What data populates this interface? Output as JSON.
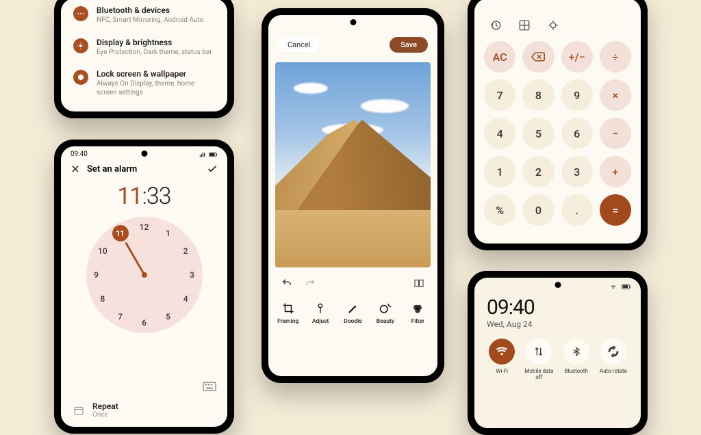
{
  "colors": {
    "accent": "#a24a1d",
    "bg": "#f4ebd7",
    "key_bg": "#f6eedd",
    "key_op": "#f3e0d8"
  },
  "settings": {
    "items": [
      {
        "title": "Bluetooth & devices",
        "sub": "NFC, Smart Mirroring, Android Auto"
      },
      {
        "title": "Display & brightness",
        "sub": "Eye Protection, Dark theme, status bar"
      },
      {
        "title": "Lock screen & wallpaper",
        "sub": "Always On Display, theme, home screen settings"
      }
    ]
  },
  "alarm": {
    "status_time": "09:40",
    "title": "Set an alarm",
    "hour": "11",
    "minute": "33",
    "selected_hour": "11",
    "repeat_label": "Repeat",
    "repeat_value": "Once"
  },
  "editor": {
    "cancel": "Cancel",
    "save": "Save",
    "tools": [
      {
        "label": "Framing"
      },
      {
        "label": "Adjust"
      },
      {
        "label": "Doodle"
      },
      {
        "label": "Beauty"
      },
      {
        "label": "Filter"
      }
    ]
  },
  "calc": {
    "keys": [
      "AC",
      "⌫",
      "+/−",
      "÷",
      "7",
      "8",
      "9",
      "×",
      "4",
      "5",
      "6",
      "−",
      "1",
      "2",
      "3",
      "+",
      "%",
      "0",
      ".",
      "="
    ]
  },
  "qs": {
    "time": "09:40",
    "date": "Wed, Aug 24",
    "tiles": [
      {
        "label": "Wi-Fi",
        "active": true
      },
      {
        "label": "Mobile data off",
        "active": false
      },
      {
        "label": "Bluetooth",
        "active": false
      },
      {
        "label": "Auto-rotate",
        "active": false
      }
    ]
  }
}
